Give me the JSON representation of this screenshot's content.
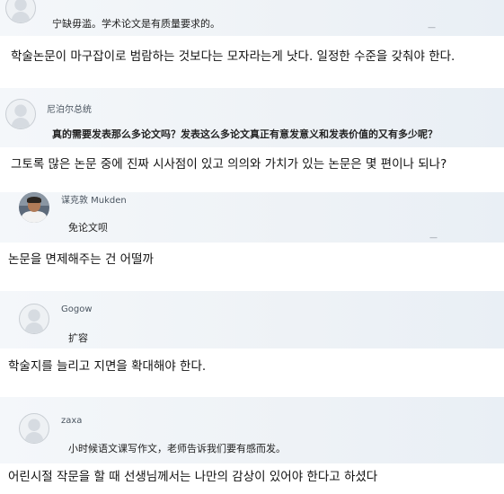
{
  "comments": [
    {
      "username": "",
      "chinese": "宁缺毋滥。学术论文是有质量要求的。",
      "korean": "학술논문이 마구잡이로 범람하는 것보다는 모자라는게 낫다. 일정한 수준을 갖춰야 한다."
    },
    {
      "username": "尼泊尔总统",
      "chinese": "真的需要发表那么多论文吗？发表这么多论文真正有意发意义和发表价值的又有多少呢？",
      "korean": "그토록 많은 논문 중에 진짜 시사점이 있고 의의와 가치가 있는 논문은 몇 편이나 되나?"
    },
    {
      "username": "谋克敦 Mukden",
      "chinese": "免论文呗",
      "korean": "논문을 면제해주는 건 어떨까"
    },
    {
      "username": "Gogow",
      "chinese": "扩容",
      "korean": "학술지를 늘리고 지면을 확대해야 한다."
    },
    {
      "username": "zaxa",
      "chinese": "小时候语文课写作文，老师告诉我们要有感而发。",
      "korean": "어린시절 작문을 할 때 선생님께서는 나만의 감상이 있어야 한다고 하셨다"
    }
  ]
}
